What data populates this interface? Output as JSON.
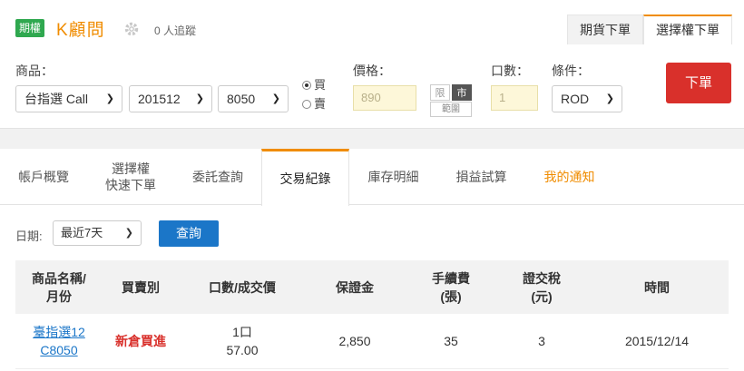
{
  "header": {
    "badge": "期權",
    "brand": "K顧問",
    "followers": "0 人追蹤",
    "tabs": [
      {
        "label": "期貨下單",
        "active": false
      },
      {
        "label": "選擇權下單",
        "active": true
      }
    ]
  },
  "order_form": {
    "product_label": "商品：",
    "product_value": "台指選 Call",
    "month_value": "201512",
    "strike_value": "8050",
    "side_options": [
      {
        "label": "買",
        "selected": true
      },
      {
        "label": "賣",
        "selected": false
      }
    ],
    "price_label": "價格：",
    "price_value": "890",
    "limit_label": "限",
    "market_label": "市",
    "range_label": "範圍",
    "qty_label": "口數：",
    "qty_value": "1",
    "condition_label": "條件：",
    "condition_value": "ROD",
    "submit_label": "下單",
    "accent_color": "#f08c00",
    "submit_color": "#d9302b"
  },
  "main": {
    "tabs": [
      {
        "label": "帳戶概覽",
        "active": false
      },
      {
        "label": "選擇權\n快速下單",
        "active": false
      },
      {
        "label": "委託查詢",
        "active": false
      },
      {
        "label": "交易紀錄",
        "active": true
      },
      {
        "label": "庫存明細",
        "active": false
      },
      {
        "label": "損益試算",
        "active": false
      },
      {
        "label": "我的通知",
        "active": false
      }
    ],
    "date_label": "日期:",
    "date_value": "最近7天",
    "query_label": "查詢",
    "table": {
      "headers": [
        "商品名稱/\n月份",
        "買賣別",
        "口數/成交價",
        "保證金",
        "手續費\n(張)",
        "證交稅\n(元)",
        "時間"
      ],
      "rows": [
        {
          "product": "臺指選12\nC8050",
          "side": "新倉買進",
          "qty_price": "1口\n57.00",
          "margin": "2,850",
          "fee": "35",
          "tax": "3",
          "time": "2015/12/14"
        }
      ]
    }
  }
}
